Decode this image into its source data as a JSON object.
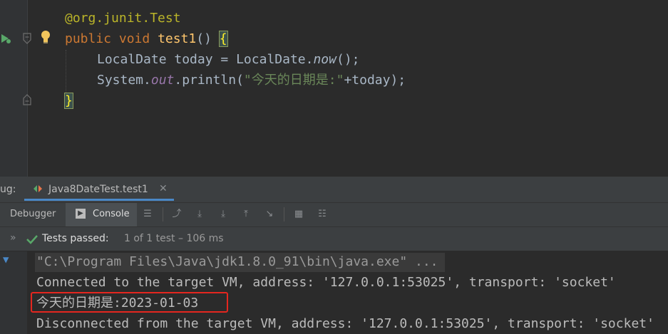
{
  "editor": {
    "line1": {
      "annotation": "@org.junit.",
      "annotation_name": "Test"
    },
    "line2": {
      "kw_public": "public",
      "kw_void": "void",
      "method": "test1",
      "paren": "() ",
      "brace": "{"
    },
    "line3": {
      "type": "LocalDate",
      "var": " today = ",
      "cls": "LocalDate.",
      "call": "now",
      "tail": "();"
    },
    "line4": {
      "cls": "System.",
      "field": "out",
      "method": ".println(",
      "str": "\"今天的日期是:\"",
      "tail": "+today);"
    },
    "line5": {
      "brace": "}"
    }
  },
  "debug_panel": {
    "label": "ug:",
    "tab_title": "Java8DateTest.test1",
    "tabs": [
      {
        "label": "Debugger"
      },
      {
        "label": "Console"
      }
    ],
    "status_passed": "Tests passed:",
    "status_detail": "1 of 1 test – 106 ms"
  },
  "console": {
    "lines": [
      "\"C:\\Program Files\\Java\\jdk1.8.0_91\\bin\\java.exe\" ...",
      "Connected to the target VM, address: '127.0.0.1:53025', transport: 'socket'",
      "今天的日期是:2023-01-03",
      "Disconnected from the target VM, address: '127.0.0.1:53025', transport: 'socket'"
    ]
  },
  "colors": {
    "highlight_box": "#e5261f",
    "pass_check": "#59a869",
    "bulb": "#f2c55c"
  }
}
